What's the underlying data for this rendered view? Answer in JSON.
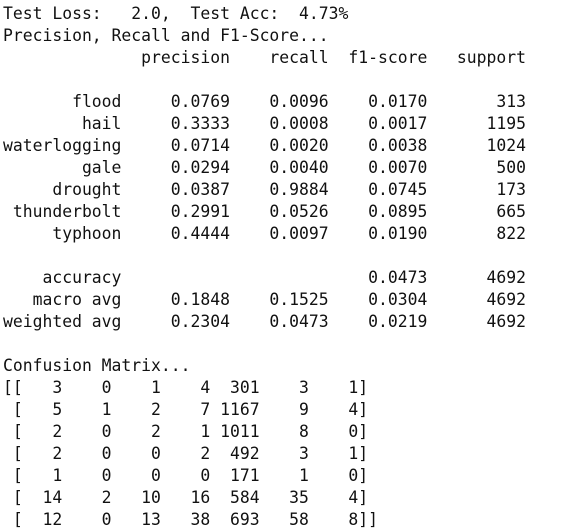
{
  "console": {
    "lines": [
      "Test Loss:   2.0,  Test Acc:  4.73%",
      "Precision, Recall and F1-Score...",
      "              precision    recall  f1-score   support",
      "",
      "       flood     0.0769    0.0096    0.0170       313",
      "        hail     0.3333    0.0008    0.0017      1195",
      "waterlogging     0.0714    0.0020    0.0038      1024",
      "        gale     0.0294    0.0040    0.0070       500",
      "     drought     0.0387    0.9884    0.0745       173",
      " thunderbolt     0.2991    0.0526    0.0895       665",
      "     typhoon     0.4444    0.0097    0.0190       822",
      "",
      "    accuracy                         0.0473      4692",
      "   macro avg     0.1848    0.1525    0.0304      4692",
      "weighted avg     0.2304    0.0473    0.0219      4692",
      "",
      "Confusion Matrix...",
      "[[   3    0    1    4  301    3    1]",
      " [   5    1    2    7 1167    9    4]",
      " [   2    0    2    1 1011    8    0]",
      " [   2    0    0    2  492    3    1]",
      " [   1    0    0    0  171    1    0]",
      " [  14    2   10   16  584   35    4]",
      " [  12    0   13   38  693   58    8]]"
    ]
  }
}
